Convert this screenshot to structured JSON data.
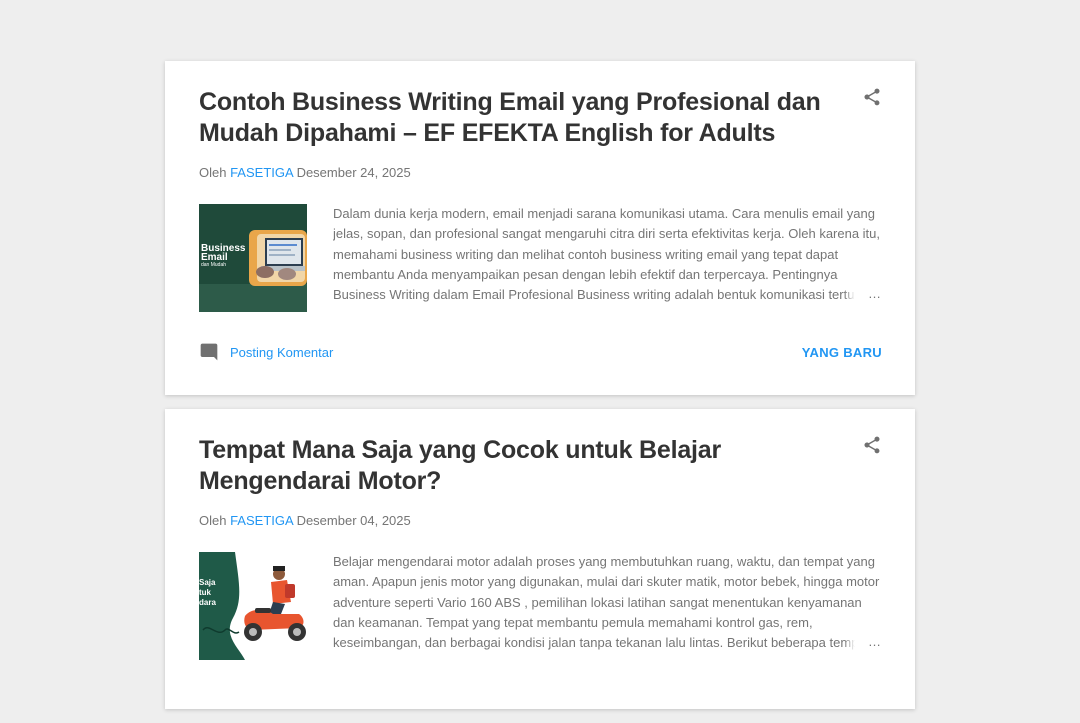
{
  "posts": [
    {
      "title": "Contoh Business Writing Email yang Profesional dan Mudah Dipahami – EF EFEKTA English for Adults",
      "by_prefix": "Oleh ",
      "author": "FASETIGA",
      "date": "Desember 24, 2025",
      "snippet": "Dalam dunia kerja modern, email menjadi sarana komunikasi utama. Cara menulis email yang jelas, sopan, dan profesional sangat mengaruhi citra diri serta efektivitas kerja. Oleh karena itu, memahami business writing dan melihat contoh business writing email yang tepat dapat membantu Anda menyampaikan pesan dengan lebih efektif dan terpercaya. Pentingnya Business Writing dalam Email Profesional Business writing adalah bentuk komunikasi tertulis yang",
      "ellipsis": "…",
      "comment_label": "Posting Komentar",
      "read_more": "YANG BARU",
      "thumb": {
        "line1": "Business",
        "line2": "Email",
        "line3": "dan Mudah",
        "bg_color": "#1f4a3a"
      }
    },
    {
      "title": "Tempat Mana Saja yang Cocok untuk Belajar Mengendarai Motor?",
      "by_prefix": "Oleh ",
      "author": "FASETIGA",
      "date": "Desember 04, 2025",
      "snippet": "Belajar mengendarai motor adalah proses yang membutuhkan ruang, waktu, dan tempat yang aman. Apapun jenis motor yang digunakan, mulai dari skuter matik, motor bebek, hingga motor adventure seperti Vario 160 ABS , pemilihan lokasi latihan sangat menentukan kenyamanan dan keamanan. Tempat yang tepat membantu pemula memahami kontrol gas, rem, keseimbangan, dan berbagai kondisi jalan tanpa tekanan lalu lintas. Berikut beberapa tempat terbaik yang bisa",
      "ellipsis": "…",
      "thumb": {
        "line1": "Saja",
        "line2": "tuk",
        "line3": "dara",
        "bg_color": "#1f5a48"
      }
    }
  ],
  "colors": {
    "link": "#2196f3",
    "title": "#333333",
    "meta": "#757575",
    "background": "#eeeeee"
  },
  "icons": {
    "share": "share-icon",
    "comment": "comment-icon"
  }
}
